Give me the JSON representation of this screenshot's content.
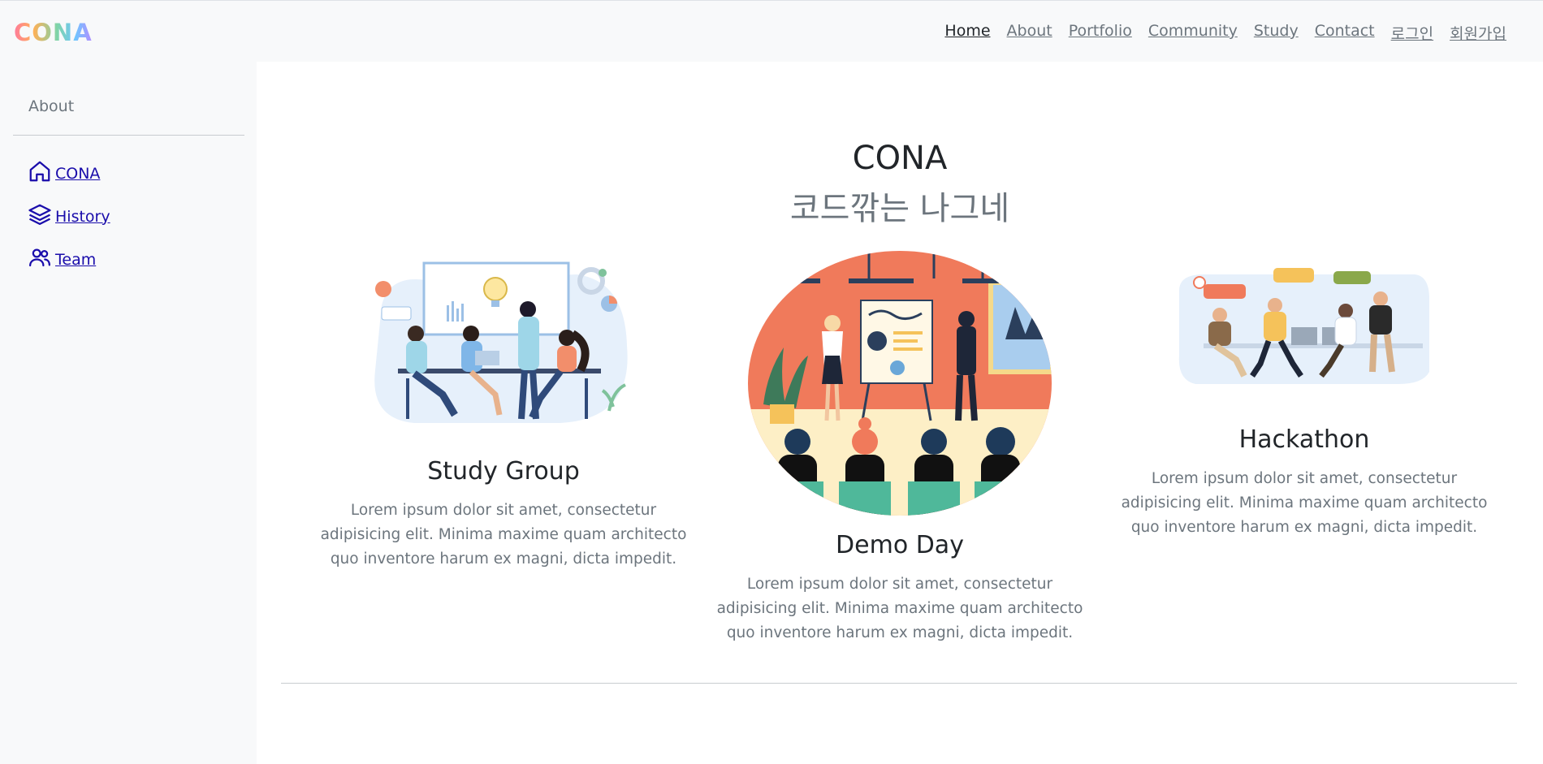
{
  "brand": {
    "logo": "CONA"
  },
  "nav": {
    "items": [
      {
        "label": "Home",
        "active": true
      },
      {
        "label": "About"
      },
      {
        "label": "Portfolio"
      },
      {
        "label": "Community"
      },
      {
        "label": "Study"
      },
      {
        "label": "Contact"
      },
      {
        "label": "로그인"
      },
      {
        "label": "회원가입"
      }
    ]
  },
  "sidebar": {
    "title": "About",
    "items": [
      {
        "label": " CONA",
        "icon": "home-icon"
      },
      {
        "label": " History",
        "icon": "layers-icon"
      },
      {
        "label": " Team",
        "icon": "users-icon"
      }
    ]
  },
  "hero": {
    "title": "CONA",
    "subtitle": "코드깎는 나그네"
  },
  "features": [
    {
      "title": "Study Group",
      "text": "Lorem ipsum dolor sit amet, consectetur adipisicing elit. Minima maxime quam architecto quo inventore harum ex magni, dicta impedit."
    },
    {
      "title": "Demo Day",
      "text": "Lorem ipsum dolor sit amet, consectetur adipisicing elit. Minima maxime quam architecto quo inventore harum ex magni, dicta impedit."
    },
    {
      "title": "Hackathon",
      "text": "Lorem ipsum dolor sit amet, consectetur adipisicing elit. Minima maxime quam architecto quo inventore harum ex magni, dicta impedit."
    }
  ],
  "colors": {
    "link": "#1a0dab",
    "muted": "#6c757d",
    "text": "#212529",
    "accent_orange": "#f07a5b"
  }
}
